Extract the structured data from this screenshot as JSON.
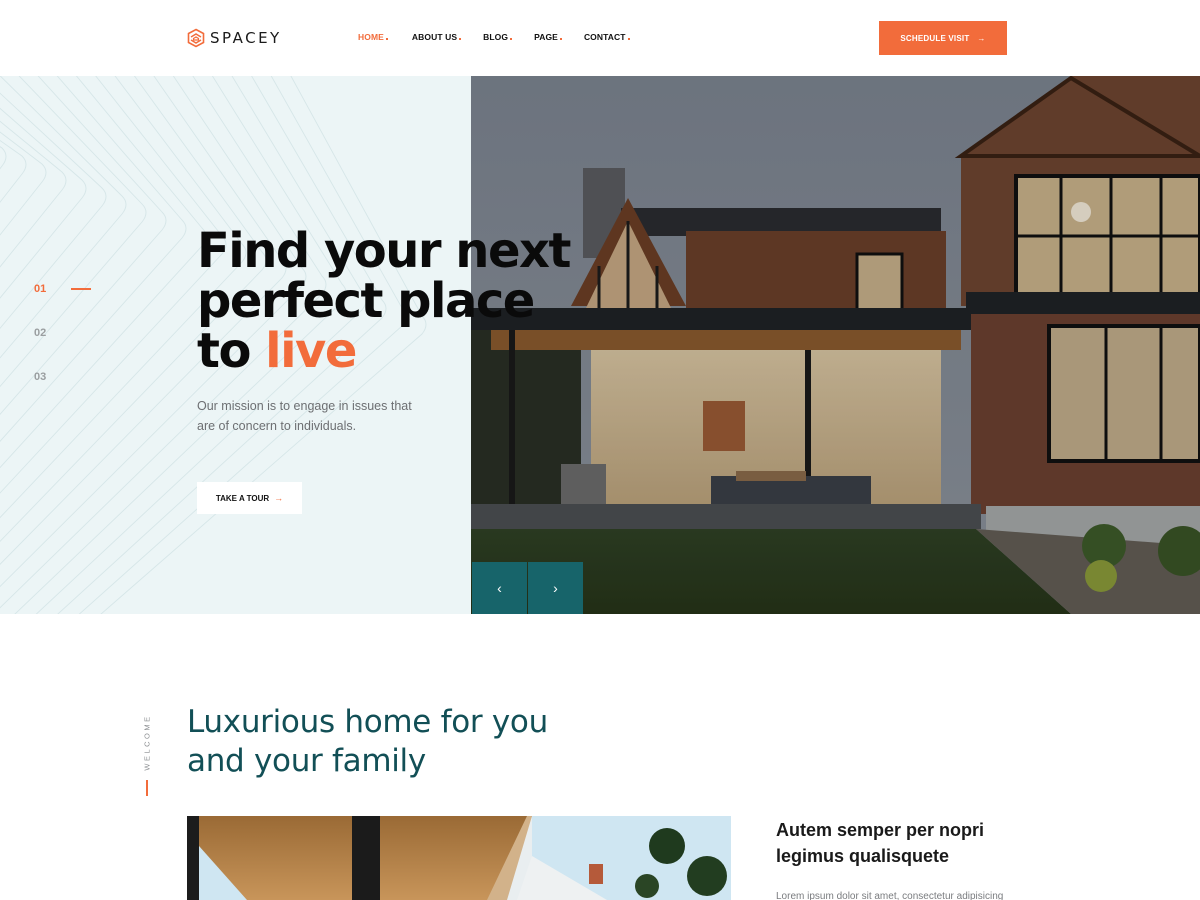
{
  "header": {
    "brand": "SPACEY",
    "nav": [
      {
        "label": "HOME",
        "active": true
      },
      {
        "label": "ABOUT US",
        "active": false
      },
      {
        "label": "BLOG",
        "active": false
      },
      {
        "label": "PAGE",
        "active": false
      },
      {
        "label": "CONTACT",
        "active": false
      }
    ],
    "cta_label": "SCHEDULE VISIT",
    "cta_arrow": "→"
  },
  "hero": {
    "title_line1": "Find your next",
    "title_line2": "perfect place",
    "title_line3_prefix": "to ",
    "title_line3_accent": "live",
    "description": "Our mission is to engage in issues that are of concern to individuals.",
    "button_label": "TAKE A TOUR",
    "button_arrow": "→",
    "slides": [
      "01",
      "02",
      "03"
    ],
    "active_slide": "01",
    "prev_icon": "‹",
    "next_icon": "›"
  },
  "welcome": {
    "label": "WELCOME",
    "title_line1": "Luxurious home for you",
    "title_line2": "and your family",
    "subtitle": "Autem semper per nopri legimus qualisquete",
    "text": "Lorem ipsum dolor sit amet, consectetur adipisicing"
  },
  "colors": {
    "accent": "#f26c3b",
    "teal": "#17646a",
    "heading_teal": "#124f56",
    "hero_bg": "#ecf5f6"
  }
}
